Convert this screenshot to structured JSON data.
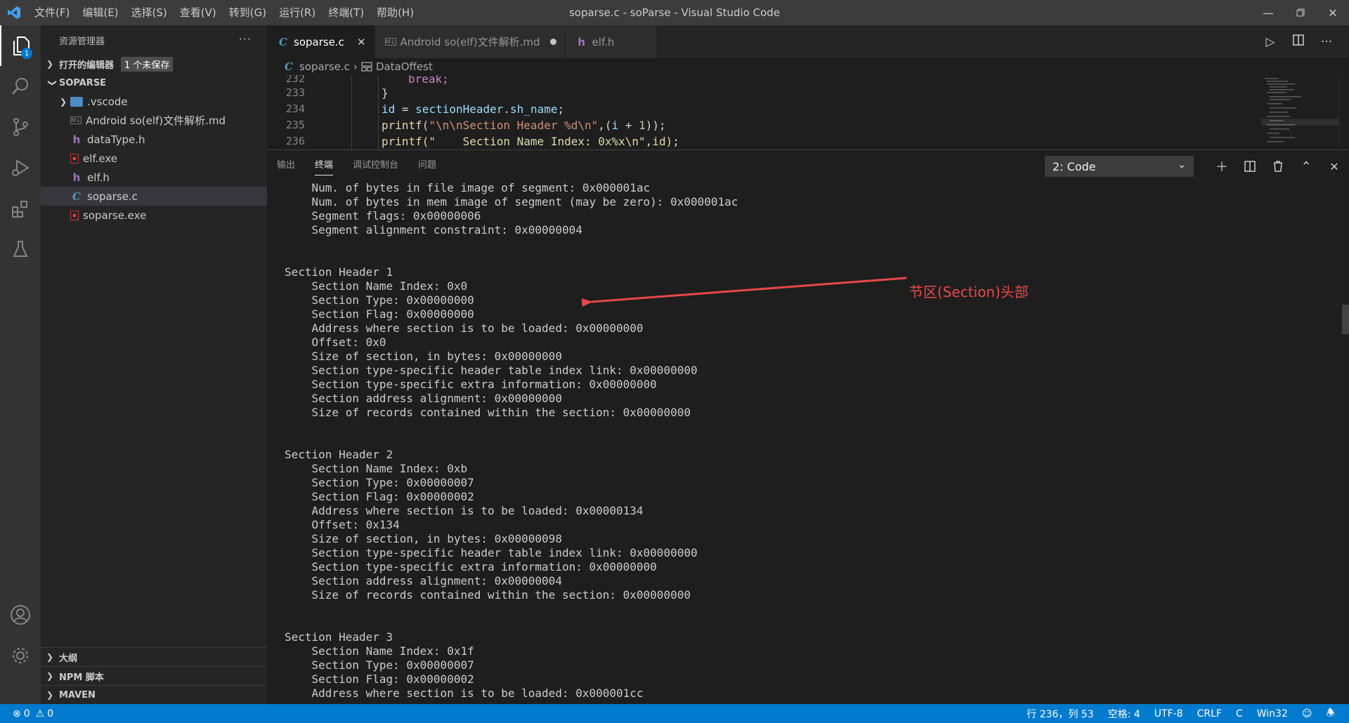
{
  "window": {
    "title": "soparse.c - soParse - Visual Studio Code",
    "menu": [
      "文件(F)",
      "编辑(E)",
      "选择(S)",
      "查看(V)",
      "转到(G)",
      "运行(R)",
      "终端(T)",
      "帮助(H)"
    ]
  },
  "activity_bar": {
    "explorer_badge": "1"
  },
  "sidebar": {
    "title": "资源管理器",
    "open_editors_label": "打开的编辑器",
    "unsaved_badge": "1 个未保存",
    "project": "SOPARSE",
    "files": [
      {
        "name": ".vscode",
        "icon": "folder-icon"
      },
      {
        "name": "Android so(elf)文件解析.md",
        "icon": "markdown-icon"
      },
      {
        "name": "dataType.h",
        "icon": "h-file-icon"
      },
      {
        "name": "elf.exe",
        "icon": "exe-file-icon"
      },
      {
        "name": "elf.h",
        "icon": "h-file-icon"
      },
      {
        "name": "soparse.c",
        "icon": "c-file-icon"
      },
      {
        "name": "soparse.exe",
        "icon": "exe-file-icon"
      }
    ],
    "bottom_sections": [
      "大纲",
      "NPM 脚本",
      "MAVEN"
    ]
  },
  "tabs": [
    {
      "label": "soparse.c",
      "active": true
    },
    {
      "label": "Android so(elf)文件解析.md",
      "active": false
    },
    {
      "label": "elf.h",
      "active": false
    }
  ],
  "breadcrumb": {
    "file": "soparse.c",
    "symbol": "DataOffest"
  },
  "code": {
    "line_numbers": [
      "232",
      "233",
      "234",
      "235",
      "236"
    ],
    "line_232": "break;",
    "line_233": "}",
    "line_234_a": "id",
    "line_234_b": " = ",
    "line_234_c": "sectionHeader",
    "line_234_d": ".",
    "line_234_e": "sh_name",
    "line_234_f": ";",
    "line_235_fn": "printf",
    "line_235_open": "(",
    "line_235_str": "\"\\n\\nSection Header %d\\n\"",
    "line_235_rest_a": ",(",
    "line_235_var": "i",
    "line_235_rest_b": " + ",
    "line_235_num": "1",
    "line_235_rest_c": "));",
    "line_236": "printf(\"    Section Name Index: 0x%x\\n\",id);"
  },
  "panel": {
    "tabs": [
      "输出",
      "终端",
      "调试控制台",
      "问题"
    ],
    "active_tab": "终端",
    "terminal_select": "2: Code",
    "terminal_lines": [
      "    Num. of bytes in file image of segment: 0x000001ac",
      "    Num. of bytes in mem image of segment (may be zero): 0x000001ac",
      "    Segment flags: 0x00000006",
      "    Segment alignment constraint: 0x00000004",
      "",
      "",
      "Section Header 1",
      "    Section Name Index: 0x0",
      "    Section Type: 0x00000000",
      "    Section Flag: 0x00000000",
      "    Address where section is to be loaded: 0x00000000",
      "    Offset: 0x0",
      "    Size of section, in bytes: 0x00000000",
      "    Section type-specific header table index link: 0x00000000",
      "    Section type-specific extra information: 0x00000000",
      "    Section address alignment: 0x00000000",
      "    Size of records contained within the section: 0x00000000",
      "",
      "",
      "Section Header 2",
      "    Section Name Index: 0xb",
      "    Section Type: 0x00000007",
      "    Section Flag: 0x00000002",
      "    Address where section is to be loaded: 0x00000134",
      "    Offset: 0x134",
      "    Size of section, in bytes: 0x00000098",
      "    Section type-specific header table index link: 0x00000000",
      "    Section type-specific extra information: 0x00000000",
      "    Section address alignment: 0x00000004",
      "    Size of records contained within the section: 0x00000000",
      "",
      "",
      "Section Header 3",
      "    Section Name Index: 0x1f",
      "    Section Type: 0x00000007",
      "    Section Flag: 0x00000002",
      "    Address where section is to be loaded: 0x000001cc"
    ]
  },
  "annotation": {
    "label": "节区(Section)头部",
    "color": "#e8484b"
  },
  "statusbar": {
    "errors": "0",
    "warnings": "0",
    "position": "行 236，列 53",
    "spaces": "空格: 4",
    "encoding": "UTF-8",
    "eol": "CRLF",
    "language": "C",
    "platform": "Win32"
  },
  "colors": {
    "accent": "#007acc",
    "titlebar": "#3c3c3c",
    "sidebar": "#252526",
    "editor": "#1e1e1e"
  }
}
